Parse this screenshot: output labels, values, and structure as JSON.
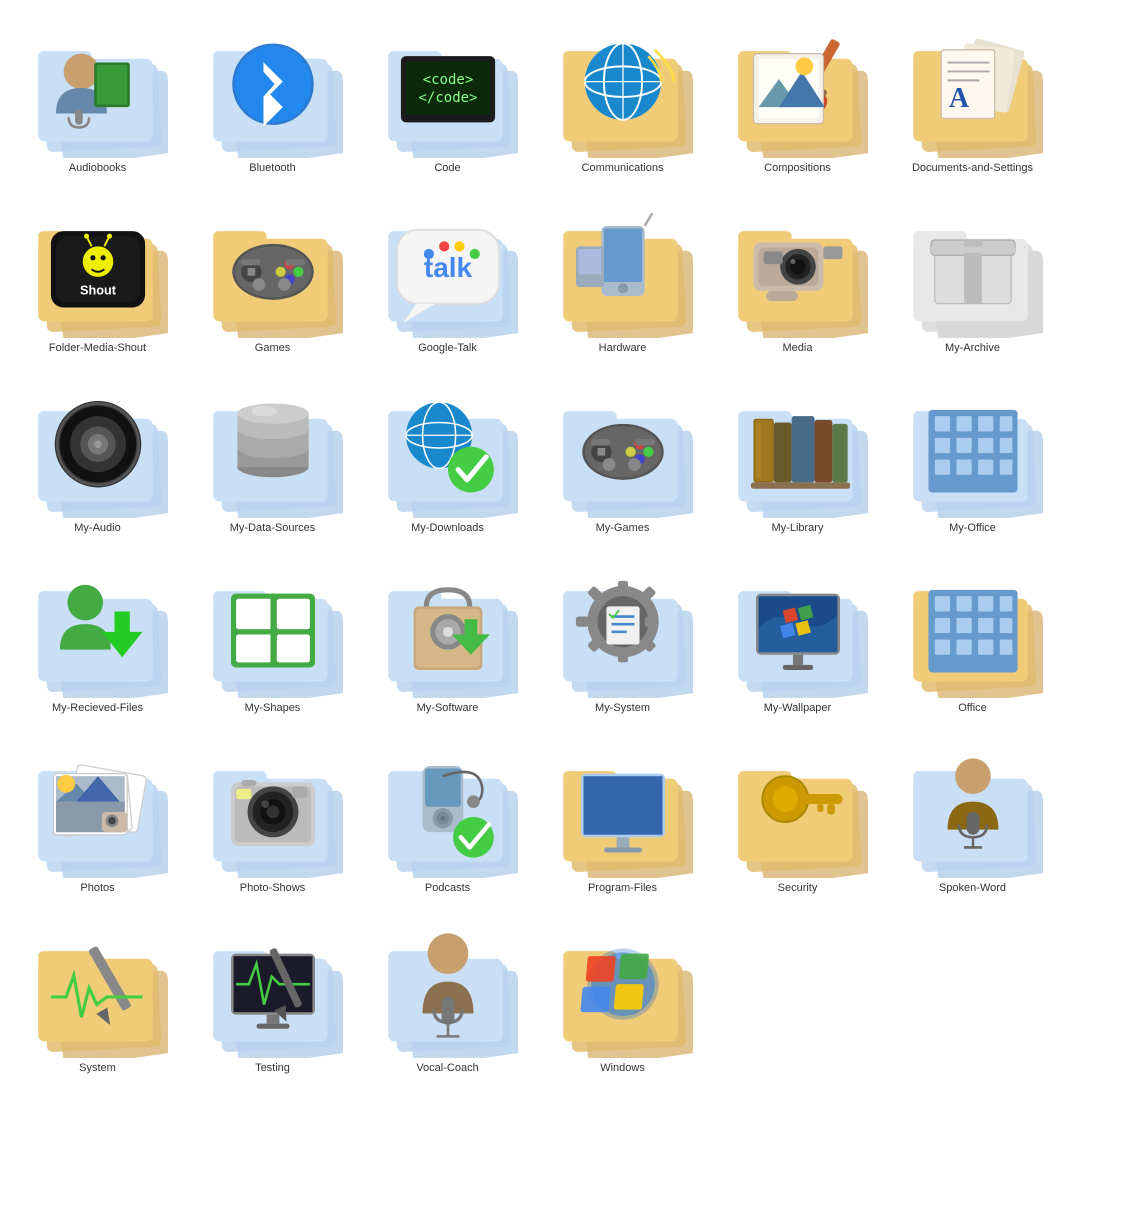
{
  "icons": [
    {
      "id": "audiobooks",
      "label": "Audiobooks",
      "type": "audiobooks"
    },
    {
      "id": "bluetooth",
      "label": "Bluetooth",
      "type": "bluetooth"
    },
    {
      "id": "code",
      "label": "Code",
      "type": "code"
    },
    {
      "id": "communications",
      "label": "Communications",
      "type": "communications"
    },
    {
      "id": "compositions",
      "label": "Compositions",
      "type": "compositions"
    },
    {
      "id": "documents-and-settings",
      "label": "Documents-and-Settings",
      "type": "documents-and-settings"
    },
    {
      "id": "folder-media-shout",
      "label": "Folder-Media-Shout",
      "type": "folder-media-shout"
    },
    {
      "id": "games",
      "label": "Games",
      "type": "games"
    },
    {
      "id": "google-talk",
      "label": "Google-Talk",
      "type": "google-talk"
    },
    {
      "id": "hardware",
      "label": "Hardware",
      "type": "hardware"
    },
    {
      "id": "media",
      "label": "Media",
      "type": "media"
    },
    {
      "id": "my-archive",
      "label": "My-Archive",
      "type": "my-archive"
    },
    {
      "id": "my-audio",
      "label": "My-Audio",
      "type": "my-audio"
    },
    {
      "id": "my-data-sources",
      "label": "My-Data-Sources",
      "type": "my-data-sources"
    },
    {
      "id": "my-downloads",
      "label": "My-Downloads",
      "type": "my-downloads"
    },
    {
      "id": "my-games",
      "label": "My-Games",
      "type": "my-games"
    },
    {
      "id": "my-library",
      "label": "My-Library",
      "type": "my-library"
    },
    {
      "id": "my-office",
      "label": "My-Office",
      "type": "my-office"
    },
    {
      "id": "my-received-files",
      "label": "My-Recieved-Files",
      "type": "my-received-files"
    },
    {
      "id": "my-shapes",
      "label": "My-Shapes",
      "type": "my-shapes"
    },
    {
      "id": "my-software",
      "label": "My-Software",
      "type": "my-software"
    },
    {
      "id": "my-system",
      "label": "My-System",
      "type": "my-system"
    },
    {
      "id": "my-wallpaper",
      "label": "My-Wallpaper",
      "type": "my-wallpaper"
    },
    {
      "id": "office",
      "label": "Office",
      "type": "office"
    },
    {
      "id": "photos",
      "label": "Photos",
      "type": "photos"
    },
    {
      "id": "photo-shows",
      "label": "Photo-Shows",
      "type": "photo-shows"
    },
    {
      "id": "podcasts",
      "label": "Podcasts",
      "type": "podcasts"
    },
    {
      "id": "program-files",
      "label": "Program-Files",
      "type": "program-files"
    },
    {
      "id": "security",
      "label": "Security",
      "type": "security"
    },
    {
      "id": "spoken-word",
      "label": "Spoken-Word",
      "type": "spoken-word"
    },
    {
      "id": "system",
      "label": "System",
      "type": "system"
    },
    {
      "id": "testing",
      "label": "Testing",
      "type": "testing"
    },
    {
      "id": "vocal-coach",
      "label": "Vocal-Coach",
      "type": "vocal-coach"
    },
    {
      "id": "windows",
      "label": "Windows",
      "type": "windows"
    }
  ]
}
